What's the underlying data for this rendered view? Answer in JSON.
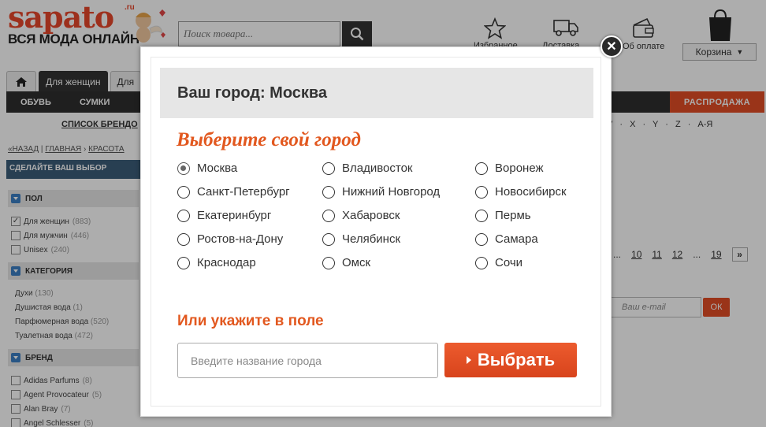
{
  "header": {
    "logo_text": "sapato",
    "logo_ru": ".ru",
    "tagline": "ВСЯ МОДА ОНЛАЙН",
    "search_placeholder": "Поиск товара...",
    "icons": [
      "star-icon",
      "truck-icon",
      "wallet-icon",
      "bag-icon"
    ],
    "favorites_label": "Избранное",
    "delivery_label": "Доставка",
    "payment_label": "Об оплате",
    "cart_label": "Корзина"
  },
  "tabs": [
    {
      "label": ""
    },
    {
      "label": "Для женщин"
    },
    {
      "label": "Для"
    }
  ],
  "nav": {
    "shoes": "ОБУВЬ",
    "bags": "СУМКИ",
    "sale": "РАСПРОДАЖА"
  },
  "brand_list_label": "СПИСОК БРЕНДО",
  "alphabet": "V · X · Y · Z · А-Я",
  "breadcrumbs": {
    "back": "«НАЗАД",
    "home": "ГЛАВНАЯ",
    "beauty": "КРАСОТА"
  },
  "filters": {
    "head": "СДЕЛАЙТЕ ВАШ ВЫБОР",
    "gender": {
      "title": "ПОЛ",
      "items": [
        {
          "label": "Для женщин",
          "count": "(883)",
          "checked": true
        },
        {
          "label": "Для мужчин",
          "count": "(446)",
          "checked": false
        },
        {
          "label": "Unisex",
          "count": "(240)",
          "checked": false
        }
      ]
    },
    "category": {
      "title": "КАТЕГОРИЯ",
      "items": [
        {
          "label": "Духи",
          "count": "(130)"
        },
        {
          "label": "Душистая вода",
          "count": "(1)"
        },
        {
          "label": "Парфюмерная вода",
          "count": "(520)"
        },
        {
          "label": "Туалетная вода",
          "count": "(472)"
        }
      ]
    },
    "brand": {
      "title": "БРЕНД",
      "items": [
        {
          "label": "Adidas Parfums",
          "count": "(8)"
        },
        {
          "label": "Agent Provocateur",
          "count": "(5)"
        },
        {
          "label": "Alan Bray",
          "count": "(7)"
        },
        {
          "label": "Angel Schlesser",
          "count": "(5)"
        }
      ]
    }
  },
  "pager": {
    "ellipsis_before": "...",
    "pages": [
      "10",
      "11",
      "12"
    ],
    "ellipsis": "...",
    "last": "19",
    "next": "»"
  },
  "email": {
    "placeholder": "Ваш e-mail",
    "ok": "ОК"
  },
  "modal": {
    "current_city": "Ваш город: Москва",
    "choose_title": "Выберите свой город",
    "cities": [
      {
        "name": "Москва",
        "selected": true
      },
      {
        "name": "Владивосток",
        "selected": false
      },
      {
        "name": "Воронеж",
        "selected": false
      },
      {
        "name": "Санкт-Петербург",
        "selected": false
      },
      {
        "name": "Нижний Новгород",
        "selected": false
      },
      {
        "name": "Новосибирск",
        "selected": false
      },
      {
        "name": "Екатеринбург",
        "selected": false
      },
      {
        "name": "Хабаровск",
        "selected": false
      },
      {
        "name": "Пермь",
        "selected": false
      },
      {
        "name": "Ростов-на-Дону",
        "selected": false
      },
      {
        "name": "Челябинск",
        "selected": false
      },
      {
        "name": "Самара",
        "selected": false
      },
      {
        "name": "Краснодар",
        "selected": false
      },
      {
        "name": "Омск",
        "selected": false
      },
      {
        "name": "Сочи",
        "selected": false
      }
    ],
    "field_title": "Или укажите в поле",
    "input_placeholder": "Введите название города",
    "submit_label": "Выбрать",
    "close_icon": "close-icon"
  },
  "colors": {
    "brand": "#e8472c",
    "accent": "#e2581f",
    "nav": "#2e2e2e",
    "filter_head": "#3b5d79"
  }
}
